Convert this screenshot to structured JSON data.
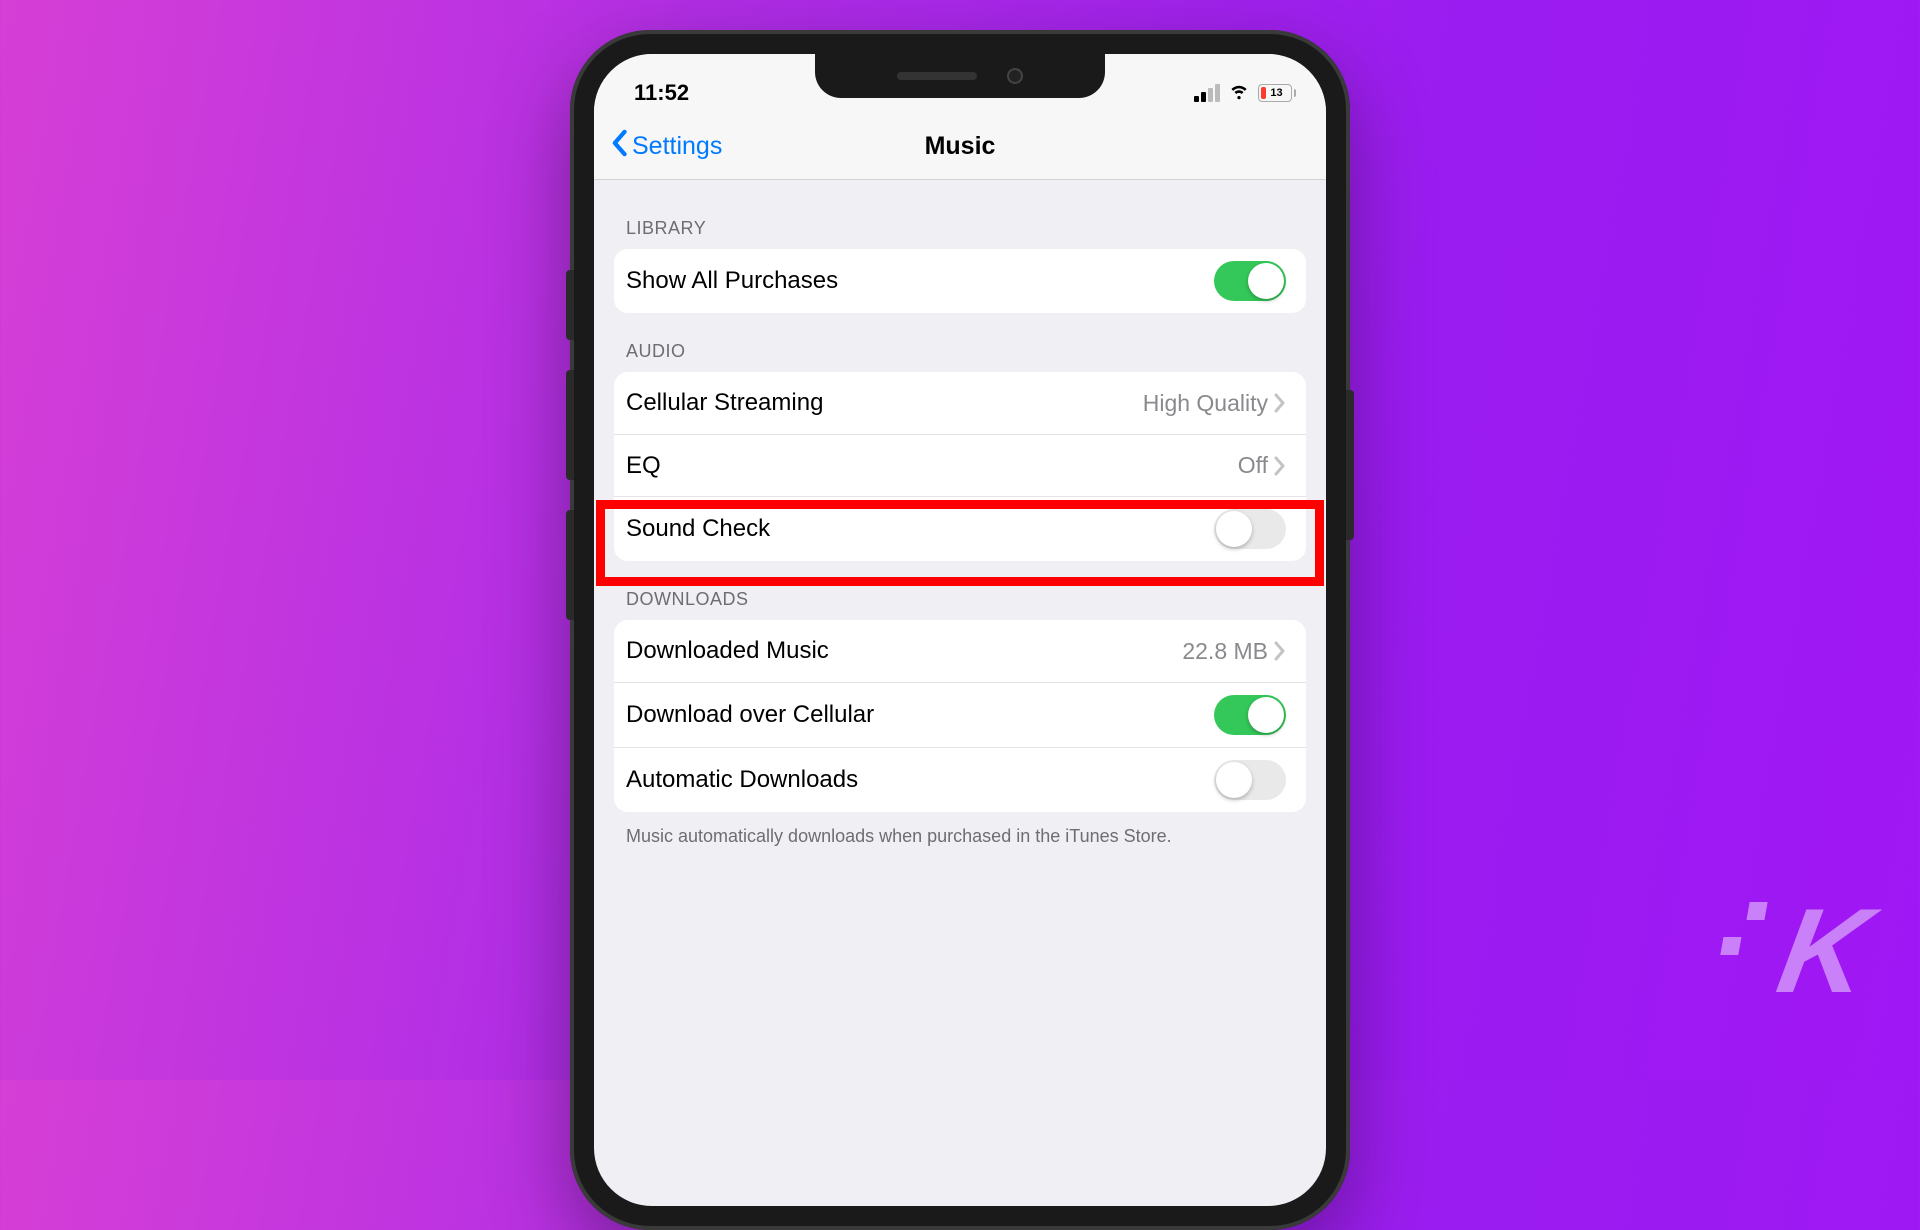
{
  "status": {
    "time": "11:52",
    "battery_pct": "13"
  },
  "nav": {
    "back": "Settings",
    "title": "Music"
  },
  "sections": {
    "library": {
      "header": "LIBRARY",
      "show_all_purchases": {
        "label": "Show All Purchases",
        "on": true
      }
    },
    "audio": {
      "header": "AUDIO",
      "cellular_streaming": {
        "label": "Cellular Streaming",
        "value": "High Quality"
      },
      "eq": {
        "label": "EQ",
        "value": "Off"
      },
      "sound_check": {
        "label": "Sound Check",
        "on": false
      }
    },
    "downloads": {
      "header": "DOWNLOADS",
      "downloaded_music": {
        "label": "Downloaded Music",
        "value": "22.8 MB"
      },
      "download_over_cellular": {
        "label": "Download over Cellular",
        "on": true
      },
      "automatic_downloads": {
        "label": "Automatic Downloads",
        "on": false
      },
      "footer": "Music automatically downloads when purchased in the iTunes Store."
    }
  },
  "watermark": "K"
}
